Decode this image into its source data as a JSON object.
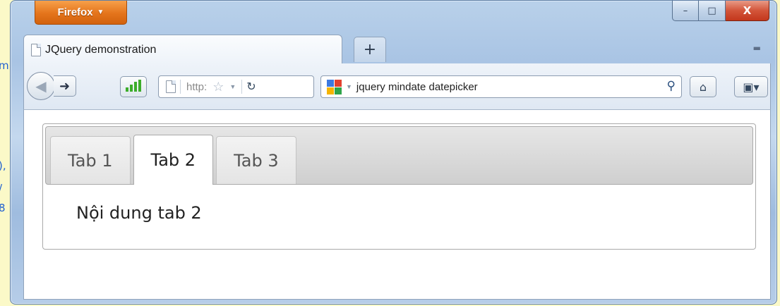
{
  "browser": {
    "menu_button_label": "Firefox",
    "menu_button_arrow": "▼",
    "window_controls": {
      "minimize": "–",
      "maximize": "□",
      "close": "X"
    },
    "tab_title": "JQuery demonstration",
    "new_tab_label": "+",
    "url_text": "http:",
    "search_text": "jquery mindate datepicker"
  },
  "page": {
    "tabs": [
      {
        "label": "Tab 1",
        "active": false
      },
      {
        "label": "Tab 2",
        "active": true
      },
      {
        "label": "Tab 3",
        "active": false
      }
    ],
    "panel_text": "Nội dung tab 2"
  },
  "colors": {
    "firefox_orange": "#e4741b",
    "close_red": "#c3371c",
    "signal_green": "#3cad2b"
  }
}
